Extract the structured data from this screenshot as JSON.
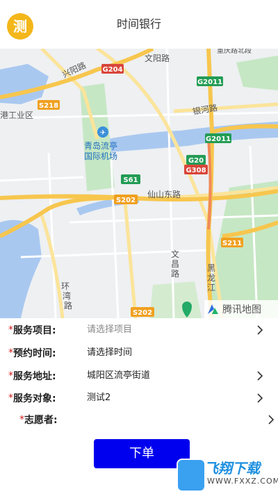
{
  "header": {
    "avatar_text": "测",
    "title": "时间银行"
  },
  "map": {
    "labels": {
      "airport": "青岛流亭\n国际机场",
      "wenyang_road": "文阳路",
      "xingyang_road": "兴阳路",
      "g204": "G204",
      "g2011_a": "G2011",
      "g2011_b": "G2011",
      "s218": "S218",
      "gang_industry": "港工业区",
      "yinhe_road": "银河路",
      "g20": "G20",
      "g308": "G308",
      "s61": "S61",
      "s202_a": "S202",
      "xianshan_east_road": "仙山东路",
      "s211": "S211",
      "wenchang_road": "文\n昌\n路",
      "heilongjiang": "黑\n龙\n江",
      "huanwan_road": "环\n湾\n路",
      "s202_b": "S202",
      "top_cut": "重庆路北段"
    },
    "provider_logo": "腾讯地图",
    "colors": {
      "land": "#eef0f2",
      "water": "#a9c8f0",
      "green": "#c6e7c4",
      "highway": "#f7c64e",
      "main_road": "#fbe49a",
      "road": "#ffffff",
      "shield_green": "#229c55",
      "shield_red": "#d9463a",
      "shield_orange": "#f0a020"
    }
  },
  "form": {
    "rows": [
      {
        "required_mark": "*",
        "label": "服务项目:",
        "value": "请选择项目",
        "placeholder": true,
        "has_chevron": true
      },
      {
        "required_mark": "*",
        "label": "预约时间:",
        "value": "请选择时间",
        "placeholder": false,
        "has_chevron": false
      },
      {
        "required_mark": "*",
        "label": "服务地址:",
        "value": "城阳区流亭街道",
        "placeholder": false,
        "has_chevron": true
      },
      {
        "required_mark": "*",
        "label": "服务对象:",
        "value": "测试2",
        "placeholder": false,
        "has_chevron": true
      },
      {
        "required_mark": "*",
        "label": "志愿者:",
        "value": "",
        "placeholder": false,
        "has_chevron": true
      }
    ],
    "submit_label": "下单"
  },
  "watermark": {
    "brand": "飞翔下载",
    "url": "WWW.FXXZ.COM"
  }
}
